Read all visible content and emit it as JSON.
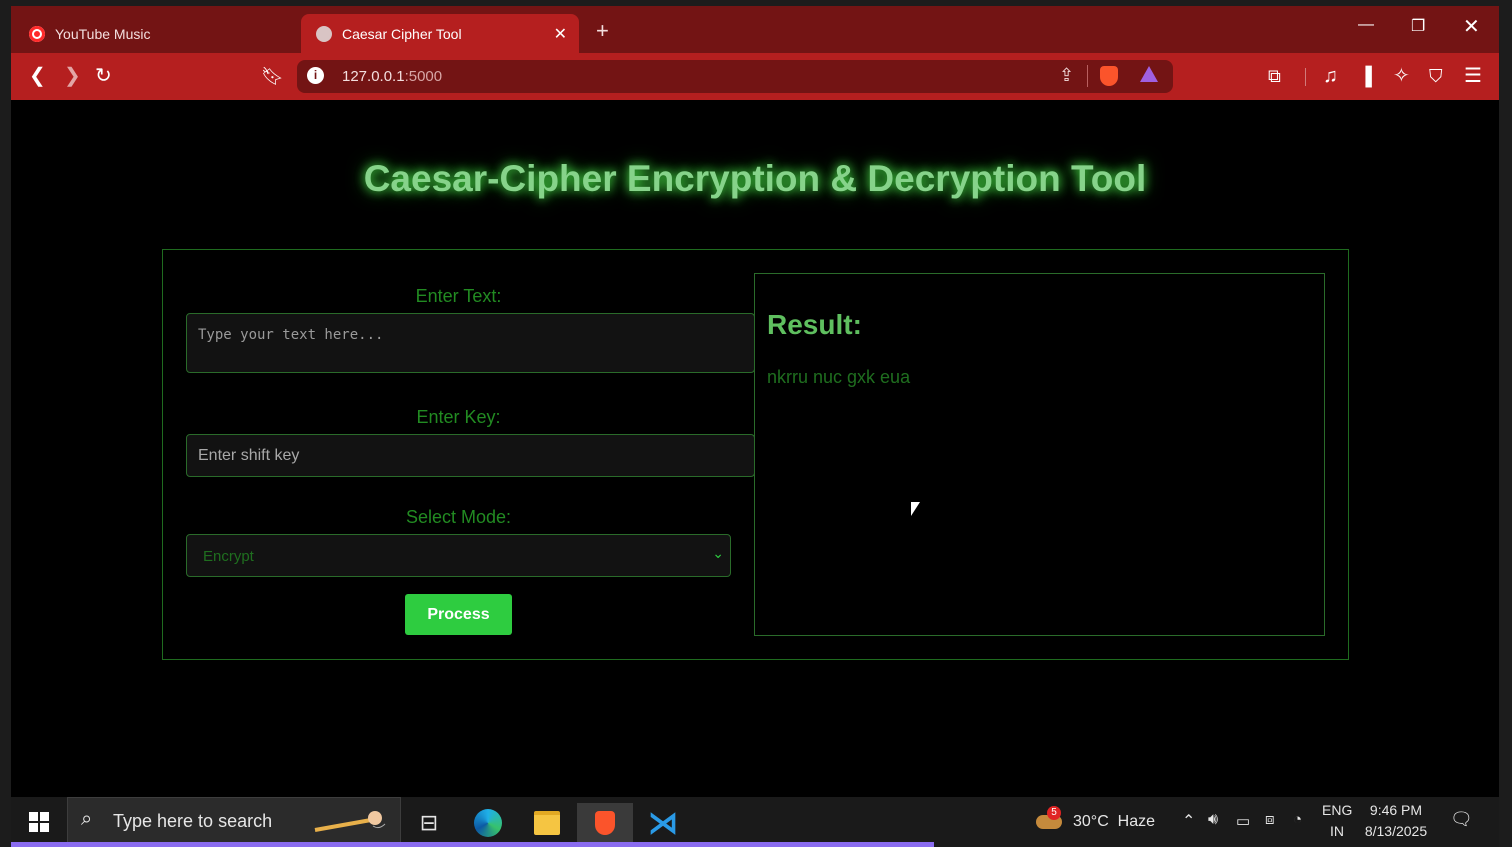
{
  "browser": {
    "tabs": [
      {
        "title": "YouTube Music",
        "active": false
      },
      {
        "title": "Caesar Cipher Tool",
        "active": true
      }
    ],
    "url_host": "127.0.0.1",
    "url_port": ":5000"
  },
  "page": {
    "title": "Caesar-Cipher Encryption & Decryption Tool",
    "text_label": "Enter Text:",
    "text_placeholder": "Type your text here...",
    "key_label": "Enter Key:",
    "key_placeholder": "Enter shift key",
    "mode_label": "Select Mode:",
    "mode_selected": "Encrypt",
    "process_button": "Process",
    "result_label": "Result:",
    "result_text": "nkrru nuc gxk eua"
  },
  "taskbar": {
    "search_placeholder": "Type here to search",
    "weather_badge": "5",
    "weather": "30°C  Haze",
    "lang_line1": "ENG",
    "lang_line2": "IN",
    "time": "9:46 PM",
    "date": "8/13/2025"
  },
  "colors": {
    "accent_green": "#2ecc40",
    "title_green": "#86d38a",
    "browser_red": "#b51f1f"
  }
}
